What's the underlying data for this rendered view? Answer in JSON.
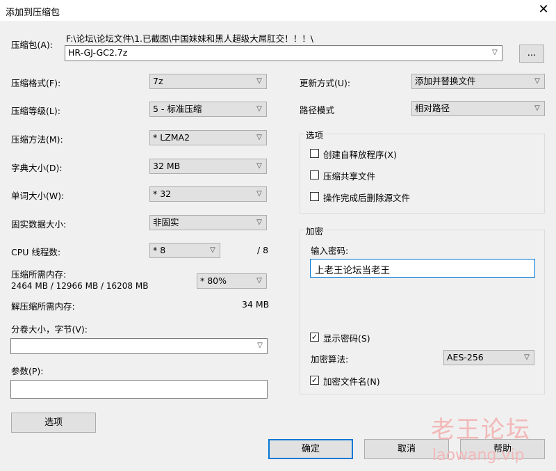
{
  "window": {
    "title": "添加到压缩包",
    "close_glyph": "✕"
  },
  "archive": {
    "label": "压缩包(A):",
    "path": "F:\\论坛\\论坛文件\\1.已截图\\中国妹妹和黑人超级大屌肛交！！！\\",
    "filename": "HR-GJ-GC2.7z",
    "browse_label": "..."
  },
  "left": {
    "format": {
      "label": "压缩格式(F):",
      "value": "7z"
    },
    "level": {
      "label": "压缩等级(L):",
      "value": "5 - 标准压缩"
    },
    "method": {
      "label": "压缩方法(M):",
      "value": "* LZMA2"
    },
    "dict": {
      "label": "字典大小(D):",
      "value": "32 MB"
    },
    "word": {
      "label": "单词大小(W):",
      "value": "* 32"
    },
    "solid": {
      "label": "固实数据大小:",
      "value": "非固实"
    },
    "cpu": {
      "label": "CPU 线程数:",
      "value": "* 8",
      "max": "/ 8"
    },
    "mem": {
      "label": "压缩所需内存:",
      "detail": "2464 MB / 12966 MB / 16208 MB",
      "value": "* 80%"
    },
    "decomp": {
      "label": "解压缩所需内存:",
      "value": "34 MB"
    },
    "volume": {
      "label": "分卷大小，字节(V):",
      "value": ""
    },
    "params": {
      "label": "参数(P):",
      "value": ""
    },
    "options_button": "选项"
  },
  "right": {
    "update": {
      "label": "更新方式(U):",
      "value": "添加并替换文件"
    },
    "pathmode": {
      "label": "路径模式",
      "value": "相对路径"
    },
    "options_group": {
      "title": "选项",
      "sfx": "创建自释放程序(X)",
      "shared": "压缩共享文件",
      "delete": "操作完成后删除源文件"
    },
    "encrypt_group": {
      "title": "加密",
      "password_label": "输入密码:",
      "password": "上老王论坛当老王",
      "show_password": "显示密码(S)",
      "algo_label": "加密算法:",
      "algo": "AES-256",
      "encrypt_names": "加密文件名(N)"
    }
  },
  "buttons": {
    "ok": "确定",
    "cancel": "取消",
    "help": "帮助"
  },
  "watermark": {
    "line1": "老王论坛",
    "line2": "laowang.vip"
  },
  "icons": {
    "chevron": "chevron-down-icon",
    "check": "✓"
  }
}
